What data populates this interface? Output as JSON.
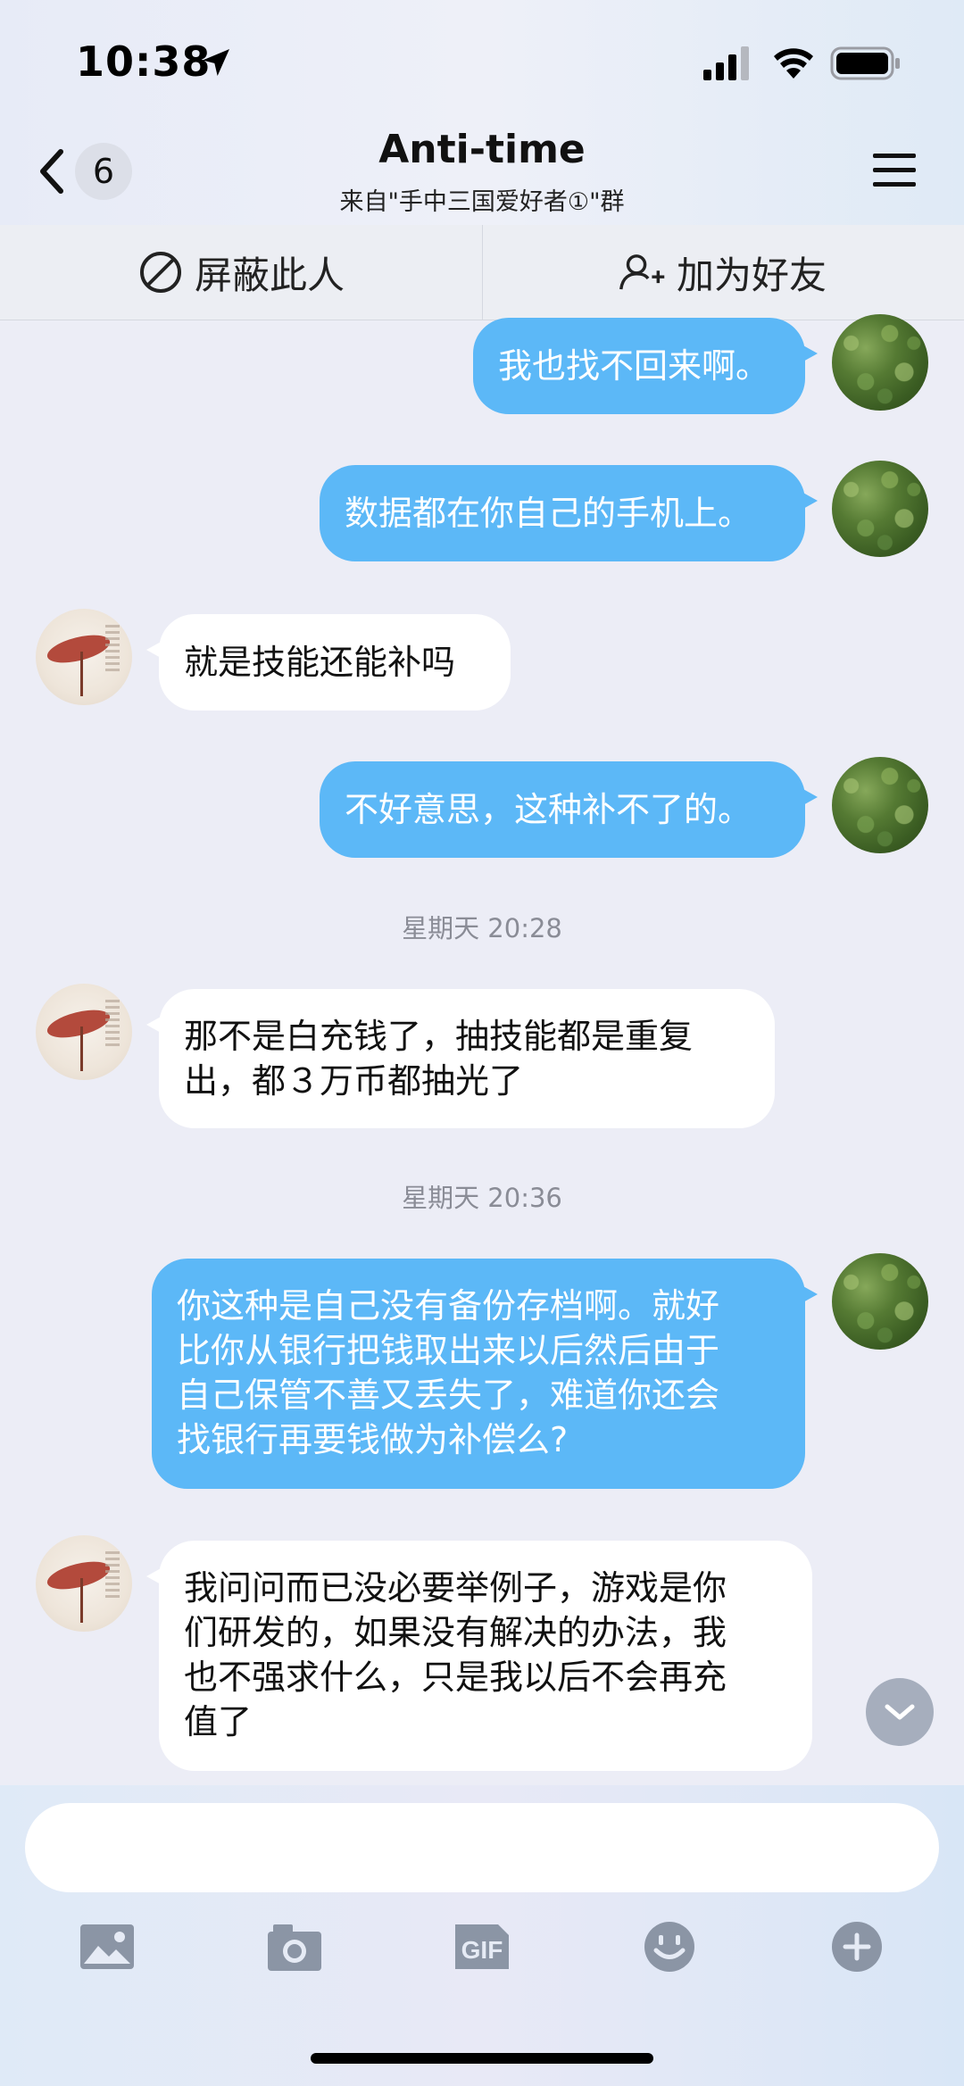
{
  "status_bar": {
    "time": "10:38"
  },
  "header": {
    "unread_count": "6",
    "title": "Anti-time",
    "subtitle": "来自\"手中三国爱好者①\"群"
  },
  "actions": {
    "block_label": "屏蔽此人",
    "add_friend_label": "加为好友"
  },
  "messages": [
    {
      "sender": "self",
      "text": "我也找不回来啊。"
    },
    {
      "sender": "self",
      "text": "数据都在你自己的手机上。"
    },
    {
      "sender": "other",
      "text": "就是技能还能补吗"
    },
    {
      "sender": "self",
      "text": "不好意思，这种补不了的。"
    },
    {
      "type": "time",
      "text": "星期天 20:28"
    },
    {
      "sender": "other",
      "lines": [
        "那不是白充钱了，抽技能都是重复",
        "出，都３万币都抽光了"
      ]
    },
    {
      "type": "time",
      "text": "星期天 20:36"
    },
    {
      "sender": "self",
      "lines": [
        "你这种是自己没有备份存档啊。就好",
        "比你从银行把钱取出来以后然后由于",
        "自己保管不善又丢失了，难道你还会",
        "找银行再要钱做为补偿么?"
      ]
    },
    {
      "sender": "other",
      "lines": [
        "我问问而已没必要举例子，游戏是你",
        "们研发的，如果没有解决的办法，我",
        "也不强求什么，只是我以后不会再充",
        "值了"
      ]
    }
  ],
  "input": {
    "placeholder": ""
  },
  "toolbar": {
    "icons": [
      "image-icon",
      "camera-icon",
      "gif-icon",
      "emoji-icon",
      "plus-icon"
    ],
    "gif_label": "GIF"
  },
  "colors": {
    "self_bubble": "#5cb8f7",
    "other_bubble": "#ffffff",
    "background": "#ecedf6"
  }
}
